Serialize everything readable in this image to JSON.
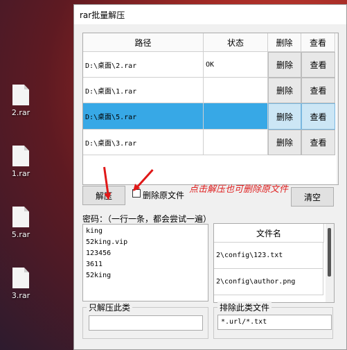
{
  "desktop": {
    "icons": [
      {
        "label": "2.rar"
      },
      {
        "label": "1.rar"
      },
      {
        "label": "5.rar"
      },
      {
        "label": "3.rar"
      }
    ]
  },
  "window": {
    "title": "rar批量解压"
  },
  "table": {
    "headers": [
      "路径",
      "状态",
      "删除",
      "查看"
    ],
    "rows": [
      {
        "path": "D:\\桌面\\2.rar",
        "status": "OK",
        "del": "删除",
        "view": "查看"
      },
      {
        "path": "D:\\桌面\\1.rar",
        "status": "",
        "del": "删除",
        "view": "查看"
      },
      {
        "path": "D:\\桌面\\5.rar",
        "status": "",
        "del": "删除",
        "view": "查看"
      },
      {
        "path": "D:\\桌面\\3.rar",
        "status": "",
        "del": "删除",
        "view": "查看"
      }
    ]
  },
  "controls": {
    "extract_label": "解压",
    "delete_source_label": "删除原文件",
    "clear_label": "清空",
    "hint": "点击解压也可删除原文件"
  },
  "password": {
    "label": "密码：（一行一条，都会尝试一遍）",
    "lines": [
      "king",
      "52king.vip",
      "123456",
      "3611",
      "52king"
    ]
  },
  "filelist": {
    "header": "文件名",
    "items": [
      "2\\config\\123.txt",
      "2\\config\\author.png"
    ]
  },
  "only_extract": {
    "label": "只解压此类",
    "value": ""
  },
  "exclude": {
    "label": "排除此类文件",
    "value": "*.url/*.txt"
  }
}
